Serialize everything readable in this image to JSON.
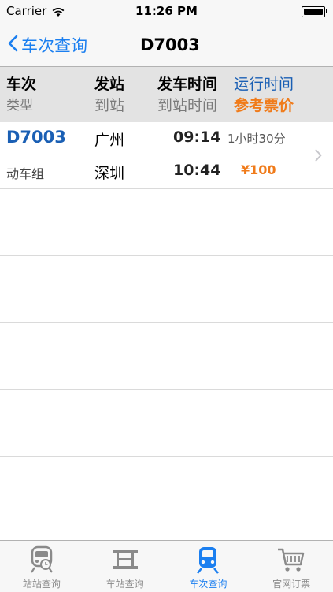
{
  "status_bar": {
    "carrier": "Carrier",
    "time": "11:26 PM"
  },
  "nav": {
    "back_label": "车次查询",
    "title": "D7003"
  },
  "columns": {
    "train": "车次",
    "type": "类型",
    "depart_station": "发站",
    "arrive_station": "到站",
    "depart_time": "发车时间",
    "arrive_time": "到站时间",
    "duration": "运行时间",
    "price": "参考票价"
  },
  "result": {
    "train_no": "D7003",
    "train_type": "动车组",
    "from": "广州",
    "to": "深圳",
    "depart": "09:14",
    "arrive": "10:44",
    "duration": "1小时30分",
    "price": "¥100"
  },
  "tabs": [
    {
      "label": "站站查询",
      "icon": "train-front-icon"
    },
    {
      "label": "车站查询",
      "icon": "station-icon"
    },
    {
      "label": "车次查询",
      "icon": "train-icon"
    },
    {
      "label": "官网订票",
      "icon": "cart-icon"
    }
  ],
  "colors": {
    "accent": "#1b7ff0",
    "train_blue": "#1a5fb4",
    "price_orange": "#f07b1a",
    "header_bg": "#e3e3e3"
  }
}
